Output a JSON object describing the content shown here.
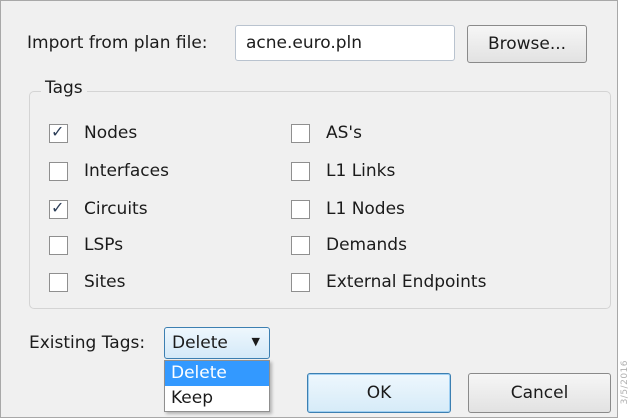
{
  "import": {
    "label": "Import from plan file:",
    "value": "acne.euro.pln",
    "browse_label": "Browse..."
  },
  "tags": {
    "title": "Tags",
    "left": [
      {
        "label": "Nodes",
        "checked": true
      },
      {
        "label": "Interfaces",
        "checked": false
      },
      {
        "label": "Circuits",
        "checked": true
      },
      {
        "label": "LSPs",
        "checked": false
      },
      {
        "label": "Sites",
        "checked": false
      }
    ],
    "right": [
      {
        "label": "AS's",
        "checked": false
      },
      {
        "label": "L1 Links",
        "checked": false
      },
      {
        "label": "L1 Nodes",
        "checked": false
      },
      {
        "label": "Demands",
        "checked": false
      },
      {
        "label": "External Endpoints",
        "checked": false
      }
    ],
    "check_glyph": "✓"
  },
  "existing_tags": {
    "label": "Existing Tags:",
    "selected": "Delete",
    "arrow": "▼",
    "options": [
      "Delete",
      "Keep"
    ]
  },
  "buttons": {
    "ok": "OK",
    "cancel": "Cancel"
  },
  "side_code": "3/5/2016",
  "colors": {
    "selection": "#3399ff",
    "focus_border": "#3c7fb1"
  }
}
